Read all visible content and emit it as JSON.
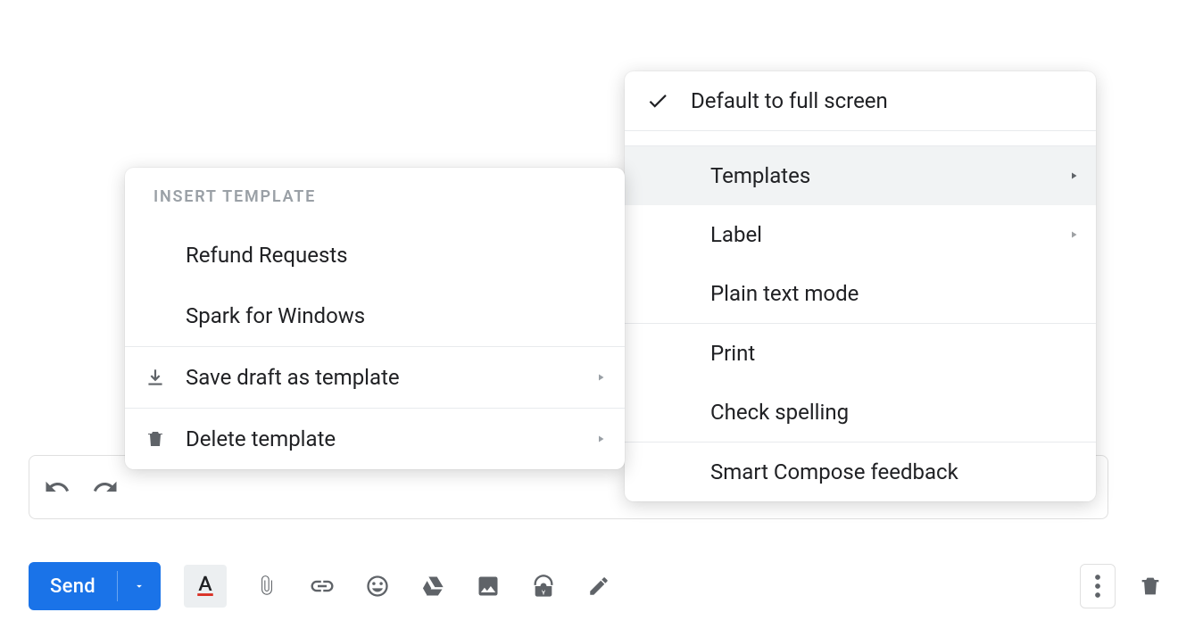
{
  "compose": {
    "send_label": "Send"
  },
  "more_menu": {
    "default_full_screen": {
      "label": "Default to full screen",
      "checked": true
    },
    "templates": {
      "label": "Templates",
      "highlighted": true
    },
    "label": {
      "label": "Label"
    },
    "plain_text": {
      "label": "Plain text mode"
    },
    "print": {
      "label": "Print"
    },
    "check_spelling": {
      "label": "Check spelling"
    },
    "smart_compose_feedback": {
      "label": "Smart Compose feedback"
    }
  },
  "templates_submenu": {
    "header": "INSERT TEMPLATE",
    "templates": [
      {
        "label": "Refund Requests"
      },
      {
        "label": "Spark for Windows"
      }
    ],
    "save_draft": "Save draft as template",
    "delete_template": "Delete template"
  },
  "icons": {
    "format": "text-format-icon",
    "attach": "attach-icon",
    "link": "link-icon",
    "emoji": "emoji-icon",
    "drive": "drive-icon",
    "image": "image-icon",
    "confidential": "confidential-icon",
    "pen": "pen-icon",
    "more": "more-vertical-icon",
    "discard": "trash-icon",
    "undo": "undo-icon",
    "redo": "redo-icon",
    "check": "check-icon",
    "submenu": "submenu-arrow-icon",
    "download": "download-icon",
    "delete": "trash-icon",
    "send_more": "caret-down-icon"
  }
}
